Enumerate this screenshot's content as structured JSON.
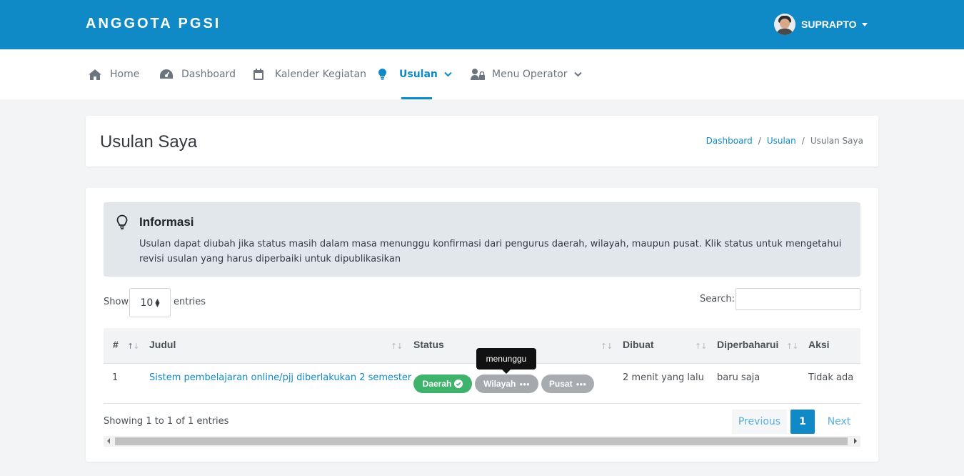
{
  "app": {
    "brand": "ANGGOTA PGSI"
  },
  "user": {
    "name": "SUPRAPTO"
  },
  "nav": {
    "items": [
      {
        "label": "Home",
        "icon": "home-icon"
      },
      {
        "label": "Dashboard",
        "icon": "dashboard-gauge-icon"
      },
      {
        "label": "Kalender Kegiatan",
        "icon": "calendar-icon"
      },
      {
        "label": "Usulan",
        "icon": "lightbulb-icon",
        "active": true
      },
      {
        "label": "Menu Operator",
        "icon": "user-lock-icon"
      }
    ]
  },
  "page": {
    "title": "Usulan Saya",
    "breadcrumb": [
      "Dashboard",
      "Usulan",
      "Usulan Saya"
    ],
    "breadcrumb_sep": "/"
  },
  "info": {
    "title": "Informasi",
    "text": "Usulan dapat diubah jika status masih dalam masa menunggu konfirmasi dari pengurus daerah, wilayah, maupun pusat. Klik status untuk mengetahui revisi usulan yang harus diperbaiki untuk dipublikasikan"
  },
  "table_controls": {
    "show_label": "Show",
    "page_length": "10",
    "entries_label": "entries",
    "search_label": "Search:",
    "search_value": ""
  },
  "table": {
    "columns": [
      "#",
      "Judul",
      "Status",
      "Dibuat",
      "Diperbaharui",
      "Aksi"
    ],
    "rows": [
      {
        "no": "1",
        "judul": "Sistem pembelajaran online/pjj diberlakukan 2 semester",
        "status": [
          {
            "label": "Daerah",
            "state": "approved",
            "icon": "check-circle-icon"
          },
          {
            "label": "Wilayah",
            "state": "waiting",
            "icon": "ellipsis-icon"
          },
          {
            "label": "Pusat",
            "state": "waiting",
            "icon": "ellipsis-icon"
          }
        ],
        "dibuat": "2 menit yang lalu",
        "diperbaharui": "baru saja",
        "aksi": "Tidak ada"
      }
    ]
  },
  "tooltip": {
    "text": "menunggu"
  },
  "footer": {
    "info": "Showing 1 to 1 of 1 entries",
    "pagination": {
      "previous": "Previous",
      "current": "1",
      "next": "Next"
    }
  },
  "colors": {
    "primary": "#0f8ac7",
    "success": "#3fb26b",
    "muted_badge": "#a5a9ae"
  }
}
